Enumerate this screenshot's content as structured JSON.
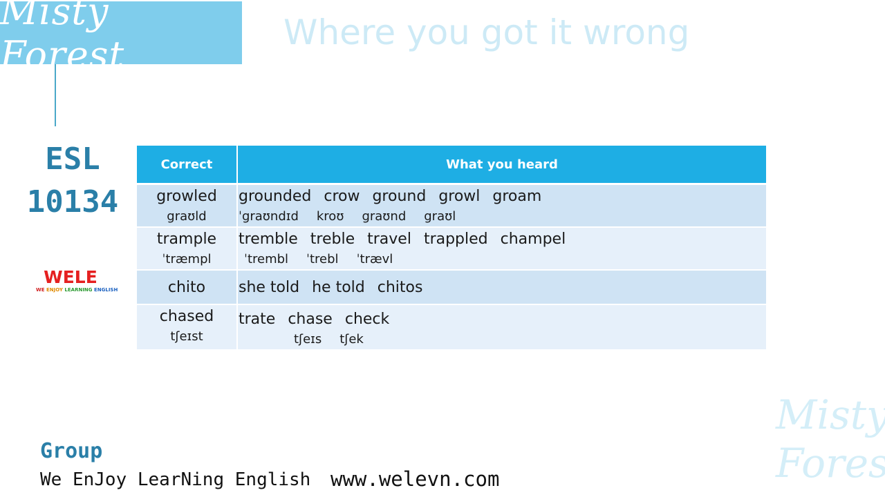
{
  "brand": {
    "title": "Misty Forest",
    "watermark_line1": "Misty",
    "watermark_line2": "Forest"
  },
  "heading": "Where you got it wrong",
  "esl": {
    "line1": "ESL",
    "line2": "10134"
  },
  "logo": {
    "letters": "WELE",
    "sub_we": "WE",
    "sub_enjoy": "ENJOY",
    "sub_learning": "LEARNING",
    "sub_english": "ENGLISH"
  },
  "table": {
    "headers": [
      "Correct",
      "What you heard"
    ],
    "rows": [
      {
        "correct": "growled",
        "correct_ipa": "graʊld",
        "heard": [
          "grounded",
          "crow",
          "ground",
          "growl",
          "groam"
        ],
        "heard_ipa": [
          "ˈgraʊndɪd",
          "kroʊ",
          "graʊnd",
          "graʊl"
        ]
      },
      {
        "correct": "trample",
        "correct_ipa": "ˈtræmpl",
        "heard": [
          "tremble",
          "treble",
          "travel",
          "trappled",
          "champel"
        ],
        "heard_ipa": [
          "ˈtrembl",
          "ˈtrebl",
          "ˈtrævl"
        ]
      },
      {
        "correct": "chito",
        "correct_ipa": "",
        "heard": [
          "she told",
          "he told",
          "chitos"
        ],
        "heard_ipa": []
      },
      {
        "correct": "chased",
        "correct_ipa": "tʃeɪst",
        "heard": [
          "trate",
          "chase",
          "check"
        ],
        "heard_ipa": [
          "tʃeɪs",
          "tʃek"
        ]
      }
    ]
  },
  "footer": {
    "group": "Group",
    "tagline": "We EnJoy LearNing English",
    "website": "www.welevn.com"
  },
  "colors": {
    "accent": "#1eaee4",
    "title_box": "#7fcdec",
    "esl": "#2a7fa8",
    "row_dark": "#cfe3f4",
    "row_light": "#e6f0fa"
  }
}
